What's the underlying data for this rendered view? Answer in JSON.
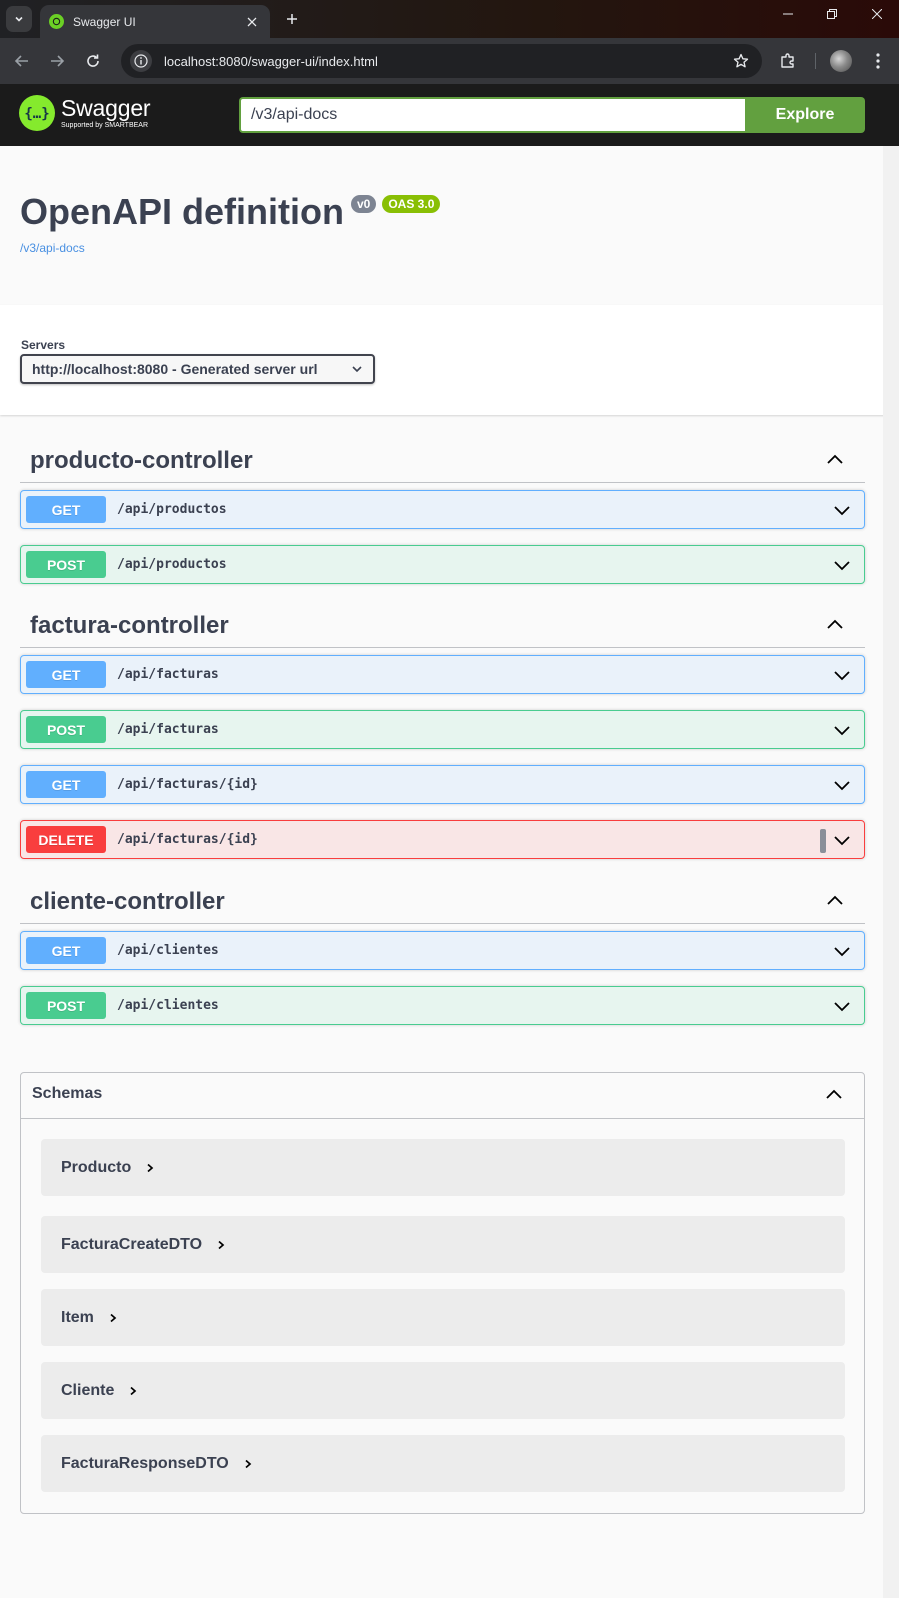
{
  "browser": {
    "tab_title": "Swagger UI",
    "url": "localhost:8080/swagger-ui/index.html"
  },
  "topbar": {
    "logo_name": "Swagger",
    "logo_sub": "Supported by SMARTBEAR",
    "url_value": "/v3/api-docs",
    "explore_label": "Explore"
  },
  "info": {
    "title": "OpenAPI definition",
    "version": "v0",
    "oas": "OAS 3.0",
    "docs_link": "/v3/api-docs"
  },
  "servers": {
    "label": "Servers",
    "selected": "http://localhost:8080 - Generated server url"
  },
  "tags": [
    {
      "name": "producto-controller",
      "operations": [
        {
          "method": "GET",
          "path": "/api/productos"
        },
        {
          "method": "POST",
          "path": "/api/productos"
        }
      ]
    },
    {
      "name": "factura-controller",
      "operations": [
        {
          "method": "GET",
          "path": "/api/facturas"
        },
        {
          "method": "POST",
          "path": "/api/facturas"
        },
        {
          "method": "GET",
          "path": "/api/facturas/{id}"
        },
        {
          "method": "DELETE",
          "path": "/api/facturas/{id}"
        }
      ]
    },
    {
      "name": "cliente-controller",
      "operations": [
        {
          "method": "GET",
          "path": "/api/clientes"
        },
        {
          "method": "POST",
          "path": "/api/clientes"
        }
      ]
    }
  ],
  "schemas": {
    "title": "Schemas",
    "items": [
      "Producto",
      "FacturaCreateDTO",
      "Item",
      "Cliente",
      "FacturaResponseDTO"
    ]
  },
  "colors": {
    "get": "#61affe",
    "post": "#49cc90",
    "delete": "#f93e3e",
    "explore": "#62a03f",
    "oas_badge": "#89bf04",
    "version_badge": "#7d8492",
    "logo": "#85ea2d"
  },
  "icons": [
    "tab-list-icon",
    "swagger-favicon-icon",
    "close-icon",
    "plus-icon",
    "minimize-icon",
    "restore-icon",
    "window-close-icon",
    "back-icon",
    "forward-icon",
    "reload-icon",
    "info-icon",
    "star-icon",
    "extensions-icon",
    "more-vert-icon",
    "chevron-up-icon",
    "chevron-down-icon",
    "chevron-right-icon"
  ]
}
